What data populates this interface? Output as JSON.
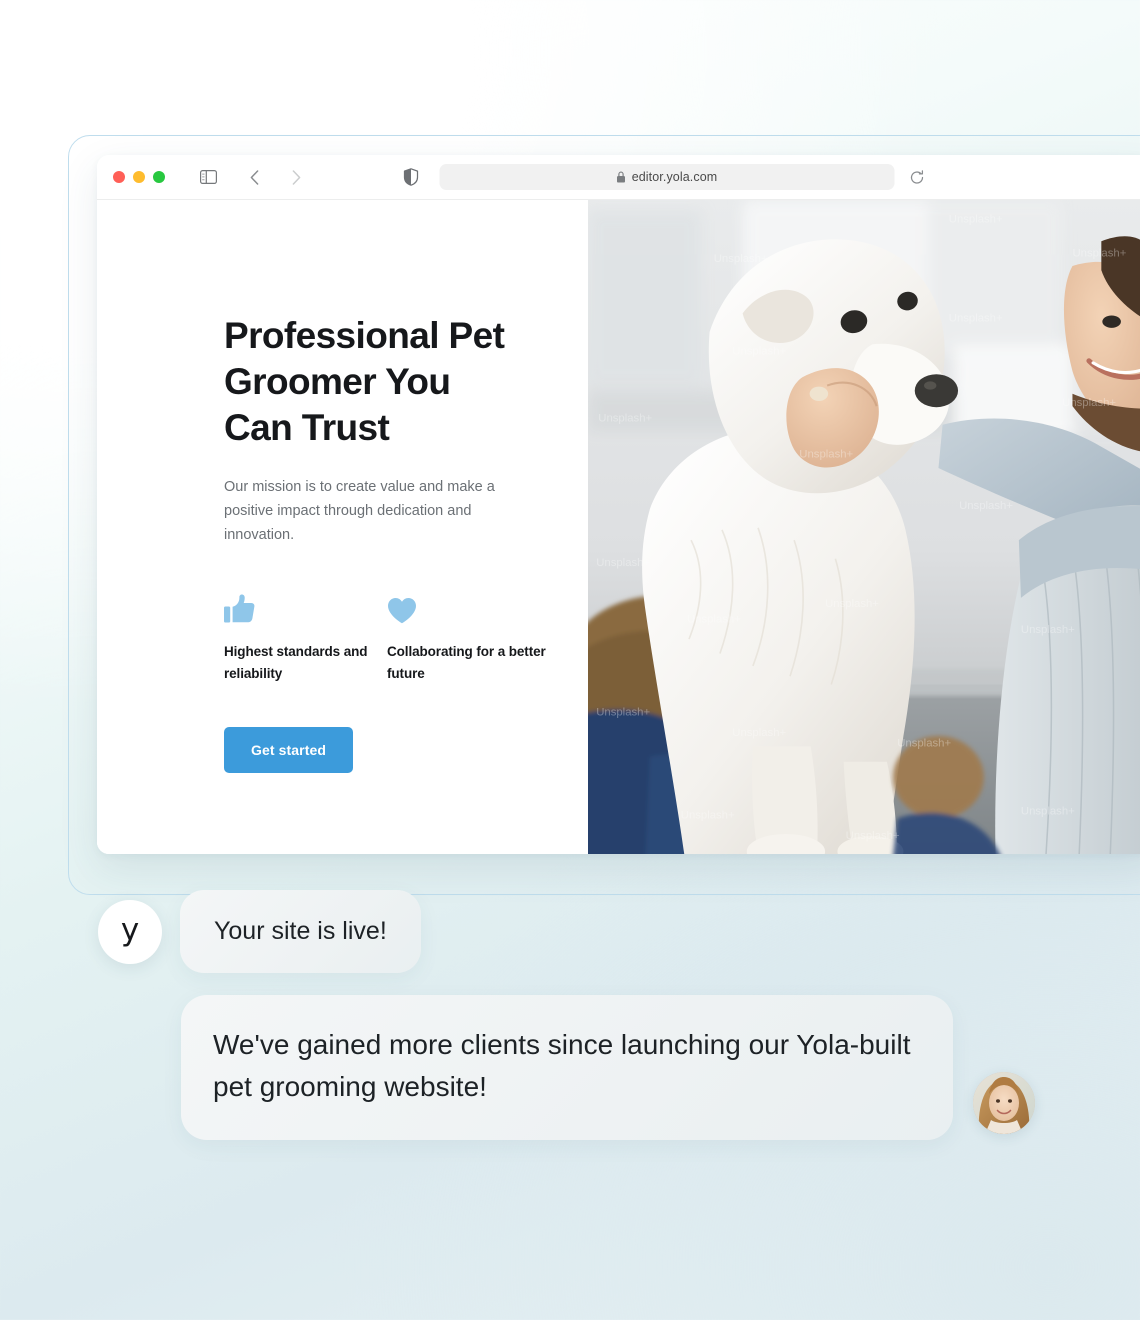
{
  "browser": {
    "url": "editor.yola.com",
    "icons": {
      "sidebar": "sidebar-toggle-icon",
      "back": "back-chevron-icon",
      "forward": "forward-chevron-icon",
      "shield": "privacy-shield-icon",
      "lock": "lock-icon",
      "reload": "reload-icon"
    },
    "traffic_lights": {
      "close": "#ff5f57",
      "minimize": "#febc2e",
      "zoom": "#28c840"
    }
  },
  "site": {
    "title": "Professional Pet Groomer You Can Trust",
    "subtitle": "Our mission is to create value and make a positive impact through dedication and innovation.",
    "features": [
      {
        "icon": "thumbs-up-icon",
        "label": "Highest standards and reliability"
      },
      {
        "icon": "heart-icon",
        "label": "Collaborating for a better future"
      }
    ],
    "cta_label": "Get started",
    "accent_color": "#3c9bdb",
    "icon_color": "#8fc6e9",
    "photo_watermark": "Unsplash+"
  },
  "chat": {
    "logo_letter": "y",
    "messages": [
      {
        "from": "yola",
        "text": "Your site is live!"
      },
      {
        "from": "user",
        "text": "We've gained more clients since launching our Yola-built pet grooming website!"
      }
    ]
  }
}
